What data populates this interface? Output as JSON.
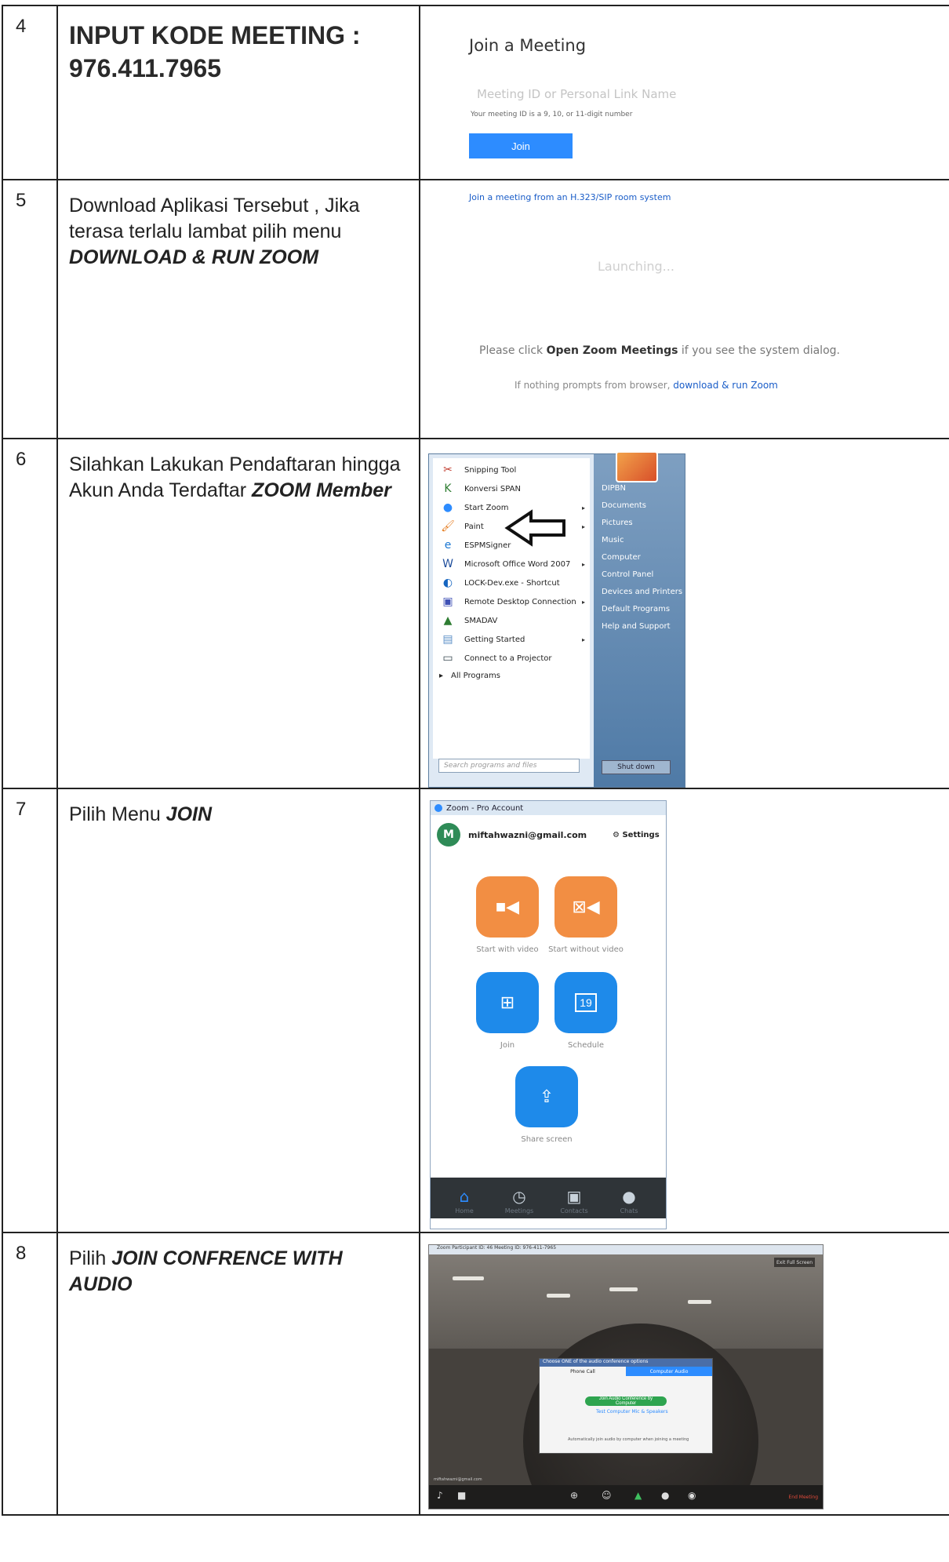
{
  "rows": [
    {
      "num": "4",
      "title_line1": "INPUT KODE MEETING :",
      "title_line2": "976.411.7965",
      "screen": {
        "heading": "Join a Meeting",
        "input_placeholder": "Meeting ID or Personal Link Name",
        "hint": "Your meeting ID is a 9, 10, or 11-digit number",
        "button": "Join",
        "link": "Join a meeting from an H.323/SIP room system"
      }
    },
    {
      "num": "5",
      "text_plain": "Download Aplikasi Tersebut , Jika terasa terlalu lambat pilih menu ",
      "text_bold": "DOWNLOAD & RUN ZOOM",
      "screen": {
        "status": "Launching...",
        "msg_prefix": "Please click ",
        "msg_bold": "Open Zoom Meetings",
        "msg_suffix": " if you see the system dialog.",
        "sub_prefix": "If nothing prompts from browser, ",
        "sub_link": "download & run Zoom"
      }
    },
    {
      "num": "6",
      "text_plain": "Silahkan Lakukan Pendaftaran hingga Akun Anda Terdaftar ",
      "text_bold": "ZOOM Member",
      "screen": {
        "left_items": [
          {
            "label": "Snipping Tool",
            "icon": "scissors-icon",
            "glyph": "✂",
            "color": "#c0392b",
            "arrow": ""
          },
          {
            "label": "Konversi SPAN",
            "icon": "k-logo-icon",
            "glyph": "K",
            "color": "#2e7d32",
            "arrow": ""
          },
          {
            "label": "Start Zoom",
            "icon": "zoom-icon",
            "glyph": "●",
            "color": "#2D8CFF",
            "arrow": "▸"
          },
          {
            "label": "Paint",
            "icon": "paint-icon",
            "glyph": "🖌",
            "color": "#e67e22",
            "arrow": "▸"
          },
          {
            "label": "ESPMSigner",
            "icon": "e-logo-icon",
            "glyph": "e",
            "color": "#1976d2",
            "arrow": ""
          },
          {
            "label": "Microsoft Office Word 2007",
            "icon": "word-icon",
            "glyph": "W",
            "color": "#1f4e9c",
            "arrow": "▸"
          },
          {
            "label": "LOCK-Dev.exe - Shortcut",
            "icon": "lock-dev-icon",
            "glyph": "◐",
            "color": "#1565c0",
            "arrow": ""
          },
          {
            "label": "Remote Desktop Connection",
            "icon": "remote-desktop-icon",
            "glyph": "▣",
            "color": "#3f51b5",
            "arrow": "▸"
          },
          {
            "label": "SMADAV",
            "icon": "smadav-icon",
            "glyph": "▲",
            "color": "#2e7d32",
            "arrow": ""
          },
          {
            "label": "Getting Started",
            "icon": "getting-started-icon",
            "glyph": "▤",
            "color": "#5c8fc7",
            "arrow": "▸"
          },
          {
            "label": "Connect to a Projector",
            "icon": "projector-icon",
            "glyph": "▭",
            "color": "#37474f",
            "arrow": ""
          }
        ],
        "all_programs": "All Programs",
        "search_placeholder": "Search programs and files",
        "right_items": [
          "DIPBN",
          "Documents",
          "Pictures",
          "Music",
          "Computer",
          "Control Panel",
          "Devices and Printers",
          "Default Programs",
          "Help and Support"
        ],
        "shutdown": "Shut down"
      }
    },
    {
      "num": "7",
      "text_plain": "Pilih Menu ",
      "text_bold": "JOIN",
      "screen": {
        "window_title": "Zoom - Pro Account",
        "avatar_letter": "M",
        "email": "miftahwazni@gmail.com",
        "settings": "Settings",
        "buttons": [
          {
            "label": "Start with video",
            "icon": "video-camera-icon"
          },
          {
            "label": "Start without video",
            "icon": "video-off-icon"
          },
          {
            "label": "Join",
            "icon": "plus-icon"
          },
          {
            "label": "Schedule",
            "icon": "calendar-icon",
            "day": "19"
          },
          {
            "label": "Share screen",
            "icon": "share-screen-icon"
          }
        ],
        "tabs": [
          "Home",
          "Meetings",
          "Contacts",
          "Chats"
        ]
      }
    },
    {
      "num": "8",
      "text_plain": "Pilih ",
      "text_bold": "JOIN CONFRENCE WITH AUDIO",
      "screen": {
        "window_title": "Zoom Participant ID: 46   Meeting ID: 976-411-7965",
        "exit_fullscreen": "Exit Full Screen",
        "dialog_title": "Choose ONE of the audio conference options",
        "tab_phone": "Phone Call",
        "tab_computer": "Computer Audio",
        "join_audio": "Join Audio Conference by Computer",
        "test_audio": "Test Computer Mic & Speakers",
        "auto_join": "Automatically join audio by computer when joining a meeting",
        "email": "miftahwazni@gmail.com",
        "end_meeting": "End Meeting"
      }
    }
  ]
}
